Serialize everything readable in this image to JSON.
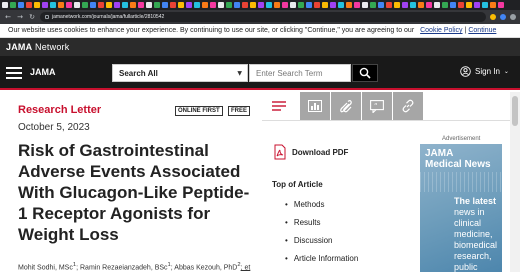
{
  "browser": {
    "url": "jamanetwork.com/journals/jama/fullarticle/2810542",
    "tab_colors": [
      "#e8eaed",
      "#34a853",
      "#4285f4",
      "#ea4335",
      "#fbbc04",
      "#a142f4",
      "#24c1e0",
      "#fa7b17",
      "#f538a0",
      "#e8eaed",
      "#34a853",
      "#4285f4",
      "#ea4335",
      "#fbbc04",
      "#a142f4",
      "#24c1e0",
      "#fa7b17",
      "#f538a0",
      "#e8eaed",
      "#34a853",
      "#4285f4",
      "#ea4335",
      "#fbbc04",
      "#a142f4",
      "#24c1e0",
      "#fa7b17",
      "#f538a0",
      "#e8eaed",
      "#34a853",
      "#4285f4",
      "#ea4335",
      "#fbbc04",
      "#a142f4",
      "#24c1e0",
      "#fa7b17",
      "#f538a0",
      "#e8eaed",
      "#34a853",
      "#4285f4",
      "#ea4335",
      "#fbbc04",
      "#a142f4",
      "#24c1e0",
      "#fa7b17",
      "#f538a0",
      "#e8eaed",
      "#34a853",
      "#4285f4",
      "#ea4335",
      "#fbbc04",
      "#a142f4",
      "#24c1e0",
      "#fa7b17",
      "#f538a0",
      "#e8eaed",
      "#34a853",
      "#4285f4",
      "#ea4335",
      "#fbbc04",
      "#a142f4",
      "#24c1e0",
      "#fa7b17",
      "#f538a0"
    ]
  },
  "cookie_banner": {
    "text": "Our website uses cookies to enhance your experience. By continuing to use our site, or clicking \"Continue,\" you are agreeing to our",
    "policy_link": "Cookie Policy",
    "separator": "|",
    "continue_link": "Continue"
  },
  "network_bar": {
    "logo_bold": "JAMA",
    "logo_rest": " Network"
  },
  "header": {
    "logo": "JAMA",
    "search_scope": "Search All",
    "search_placeholder": "Enter Search Term",
    "signin": "Sign In"
  },
  "article": {
    "type": "Research Letter",
    "badge_online": "ONLINE FIRST",
    "badge_free": "FREE",
    "date": "October 5, 2023",
    "title": "Risk of Gastrointestinal Adverse Events Associated With Glucagon-Like Peptide-1 Receptor Agonists for Weight Loss",
    "authors_line": "Mohit Sodhi, MSc",
    "author1_sup": "1",
    "author2": "; Ramin Rezaeianzadeh, BSc",
    "author2_sup": "1",
    "author3": "; Abbas Kezouh, PhD",
    "author3_sup": "2",
    "etal": "; et"
  },
  "sidebar": {
    "download_pdf": "Download PDF",
    "top_of_article": "Top of Article",
    "toc": [
      "Methods",
      "Results",
      "Discussion",
      "Article Information"
    ]
  },
  "ad": {
    "label": "Advertisement",
    "brand_line1": "JAMA",
    "brand_line2": "Medical News",
    "tag_line1": "The latest",
    "tag_line2": "news in",
    "tag_line3": "clinical",
    "tag_line4": "medicine,",
    "tag_line5": "biomedical",
    "tag_line6": "research,",
    "tag_line7": "public health,"
  },
  "colors": {
    "accent_red": "#c8102e",
    "header_bg": "#191919",
    "toolbar_gray": "#a6a6a6"
  }
}
